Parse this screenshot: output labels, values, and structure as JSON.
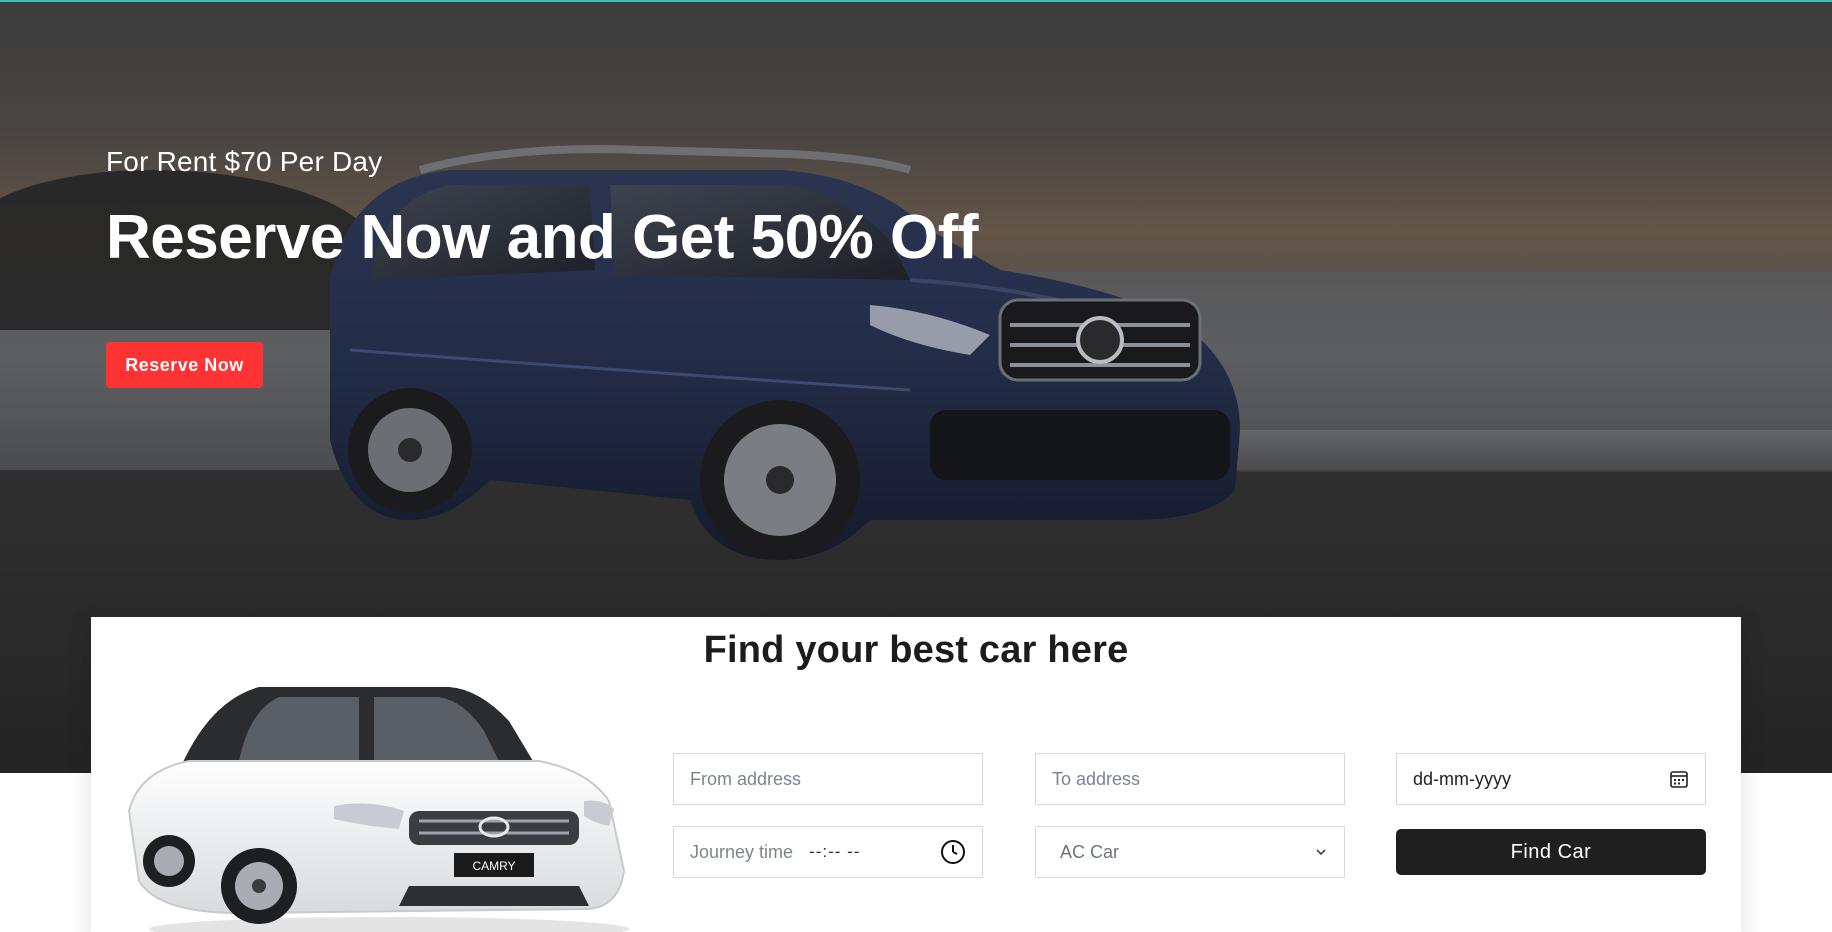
{
  "hero": {
    "subtitle": "For Rent $70 Per Day",
    "title": "Reserve Now and Get 50% Off",
    "cta_label": "Reserve Now"
  },
  "search": {
    "title": "Find your best car here",
    "from_placeholder": "From address",
    "to_placeholder": "To address",
    "date_value": "dd-mm-yyyy",
    "time_label": "Journey time",
    "time_value": "--:-- --",
    "car_type_selected": "AC Car",
    "find_label": "Find Car",
    "plate_text": "CAMRY"
  },
  "colors": {
    "accent_red": "#ff3333",
    "button_dark": "#1f1f1f",
    "top_line": "#3fbfb4"
  },
  "icons": [
    "calendar-icon",
    "clock-icon",
    "chevron-down-icon"
  ]
}
